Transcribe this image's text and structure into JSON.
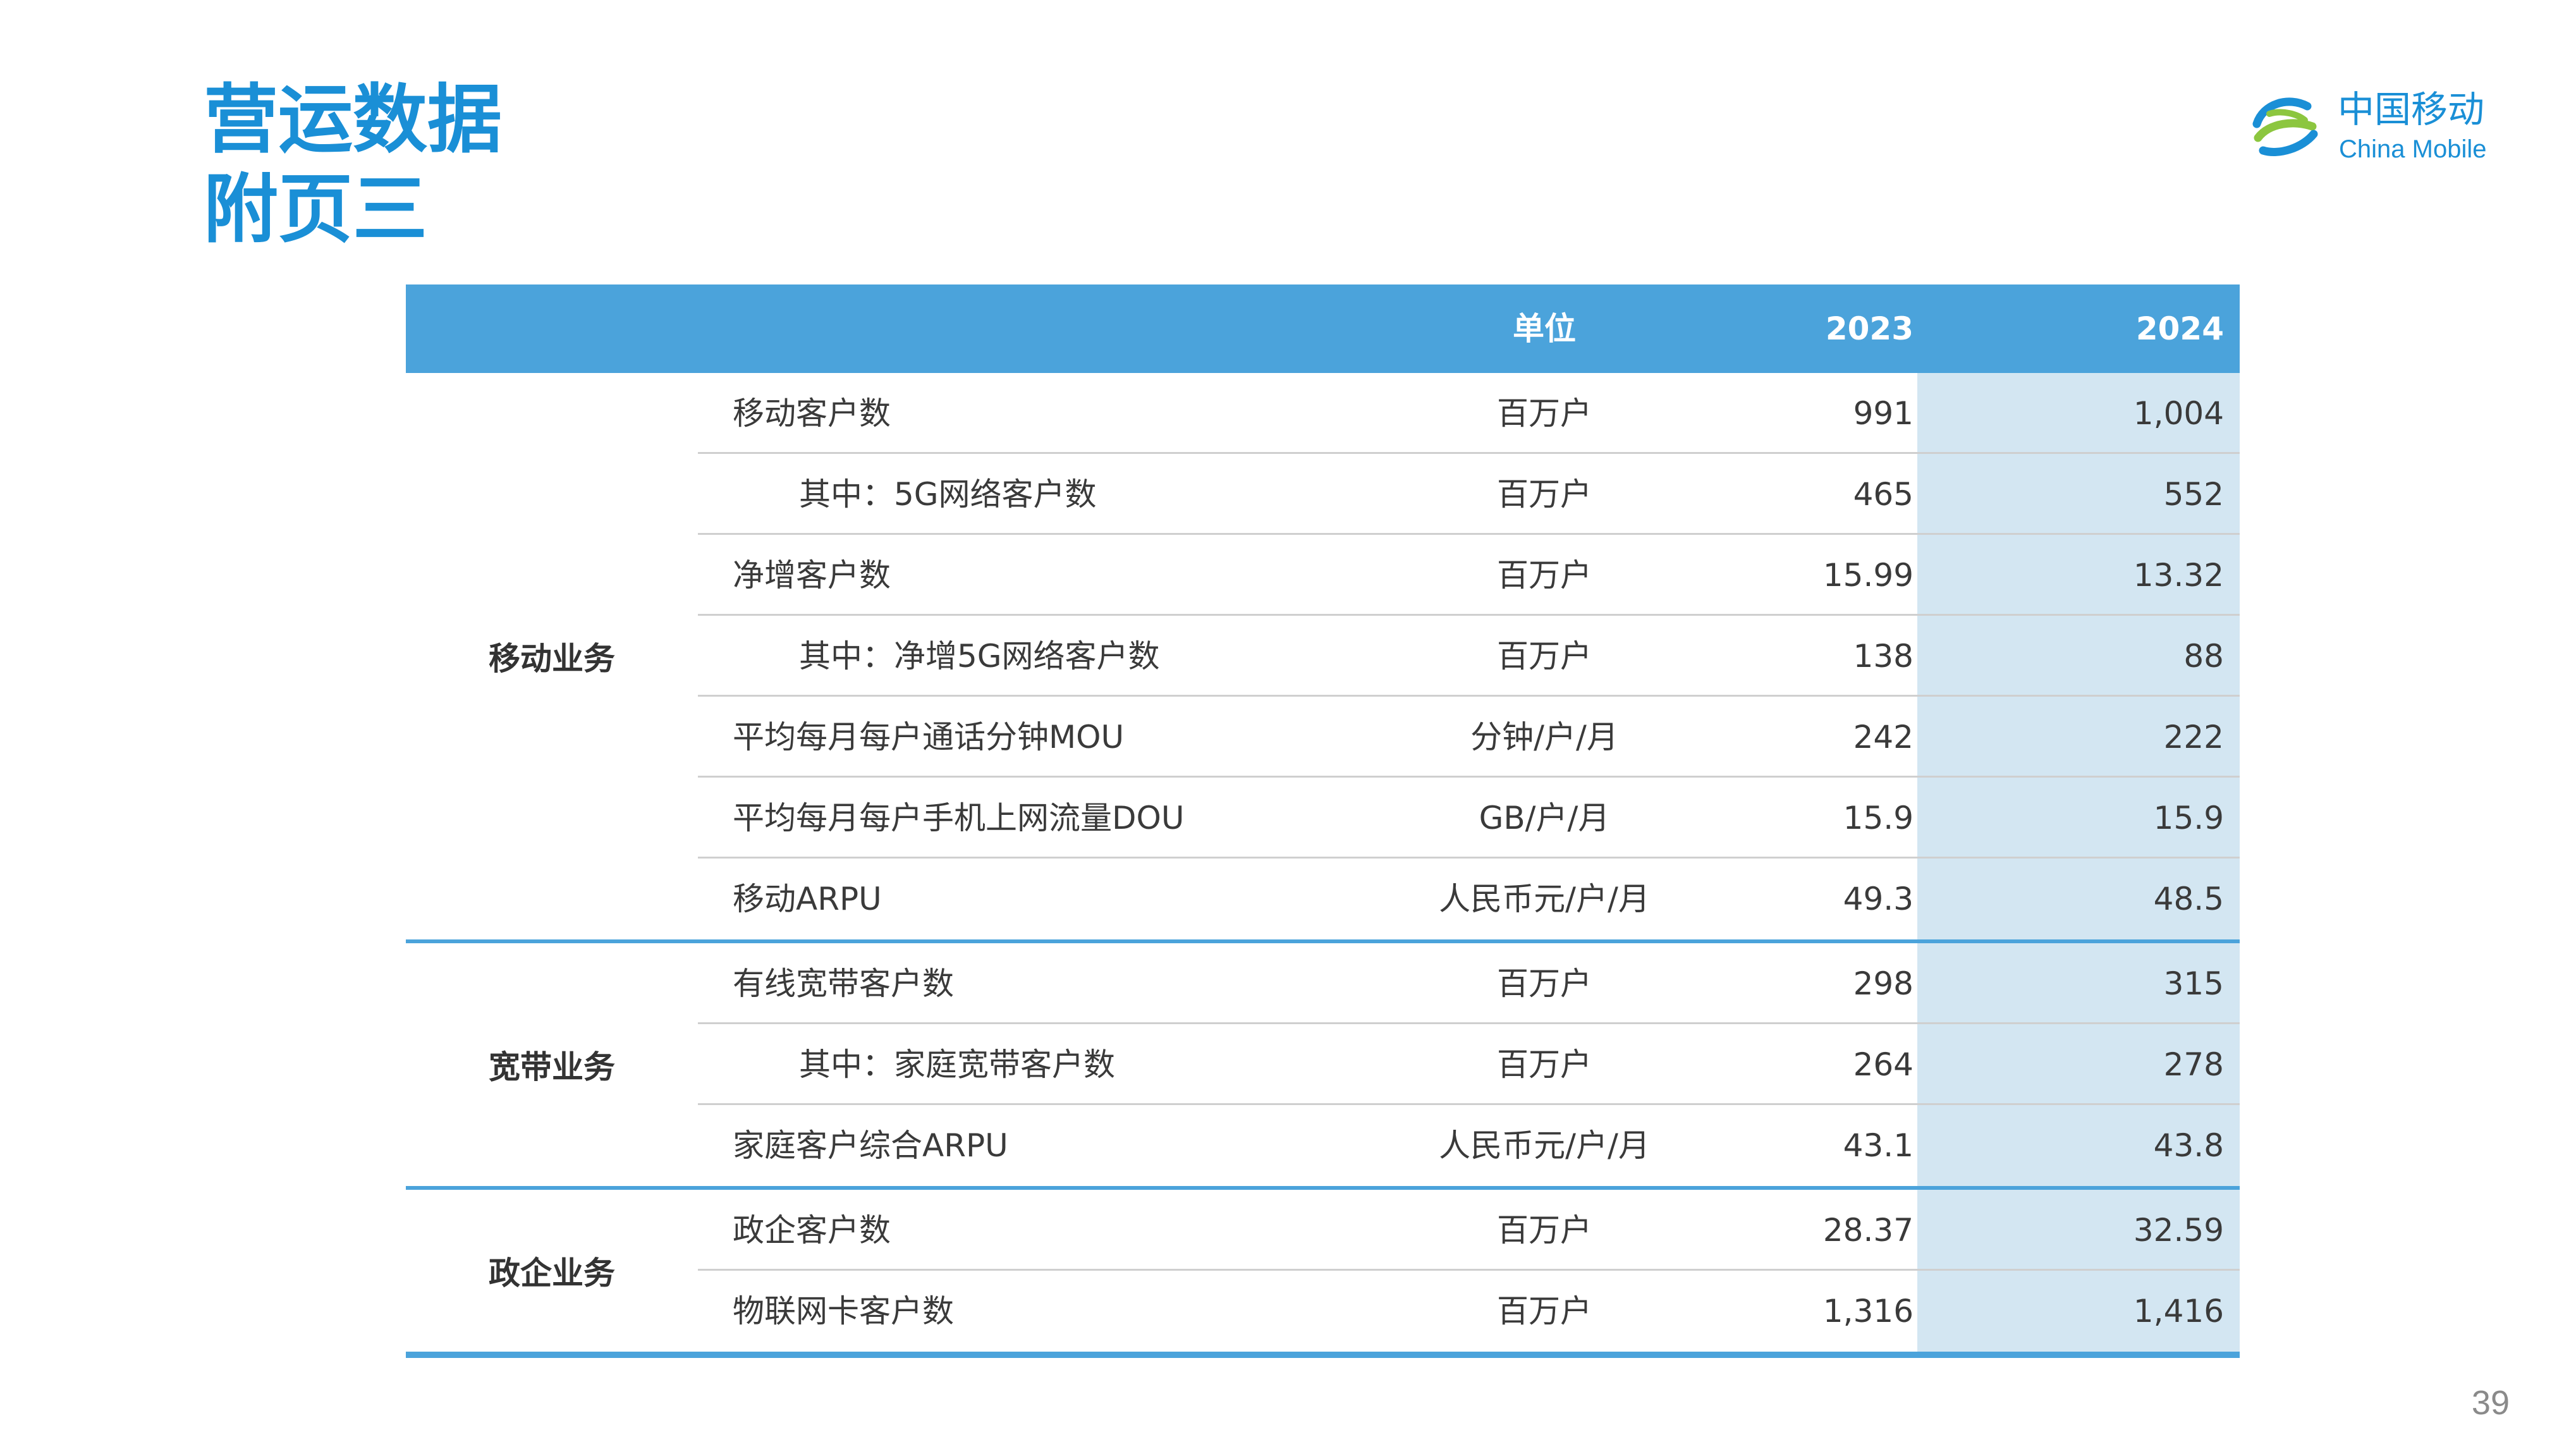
{
  "title": {
    "line1": "营运数据",
    "line2": "附页三"
  },
  "logo": {
    "cn": "中国移动",
    "en": "China Mobile",
    "icon": "china-mobile-logo-icon",
    "color": "#1a8fd6"
  },
  "colors": {
    "header_bg": "#4ba3db",
    "highlight_col": "#d3e6f2",
    "title": "#1a8fd6"
  },
  "table": {
    "headers": {
      "category": "",
      "item": "",
      "unit": "单位",
      "y2023": "2023",
      "y2024": "2024"
    },
    "groups": [
      {
        "label": "移动业务",
        "rows": [
          {
            "name": "移动客户数",
            "unit": "百万户",
            "y2023": "991",
            "y2024": "1,004"
          },
          {
            "name": "其中：5G网络客户数",
            "unit": "百万户",
            "y2023": "465",
            "y2024": "552"
          },
          {
            "name": "净增客户数",
            "unit": "百万户",
            "y2023": "15.99",
            "y2024": "13.32"
          },
          {
            "name": "其中：净增5G网络客户数",
            "unit": "百万户",
            "y2023": "138",
            "y2024": "88"
          },
          {
            "name": "平均每月每户通话分钟MOU",
            "unit": "分钟/户/月",
            "y2023": "242",
            "y2024": "222"
          },
          {
            "name": "平均每月每户手机上网流量DOU",
            "unit": "GB/户/月",
            "y2023": "15.9",
            "y2024": "15.9"
          },
          {
            "name": "移动ARPU",
            "unit": "人民币元/户/月",
            "y2023": "49.3",
            "y2024": "48.5"
          }
        ]
      },
      {
        "label": "宽带业务",
        "rows": [
          {
            "name": "有线宽带客户数",
            "unit": "百万户",
            "y2023": "298",
            "y2024": "315"
          },
          {
            "name": "其中：家庭宽带客户数",
            "unit": "百万户",
            "y2023": "264",
            "y2024": "278"
          },
          {
            "name": "家庭客户综合ARPU",
            "unit": "人民币元/户/月",
            "y2023": "43.1",
            "y2024": "43.8"
          }
        ]
      },
      {
        "label": "政企业务",
        "rows": [
          {
            "name": "政企客户数",
            "unit": "百万户",
            "y2023": "28.37",
            "y2024": "32.59"
          },
          {
            "name": "物联网卡客户数",
            "unit": "百万户",
            "y2023": "1,316",
            "y2024": "1,416"
          }
        ]
      }
    ]
  },
  "page_number": "39"
}
